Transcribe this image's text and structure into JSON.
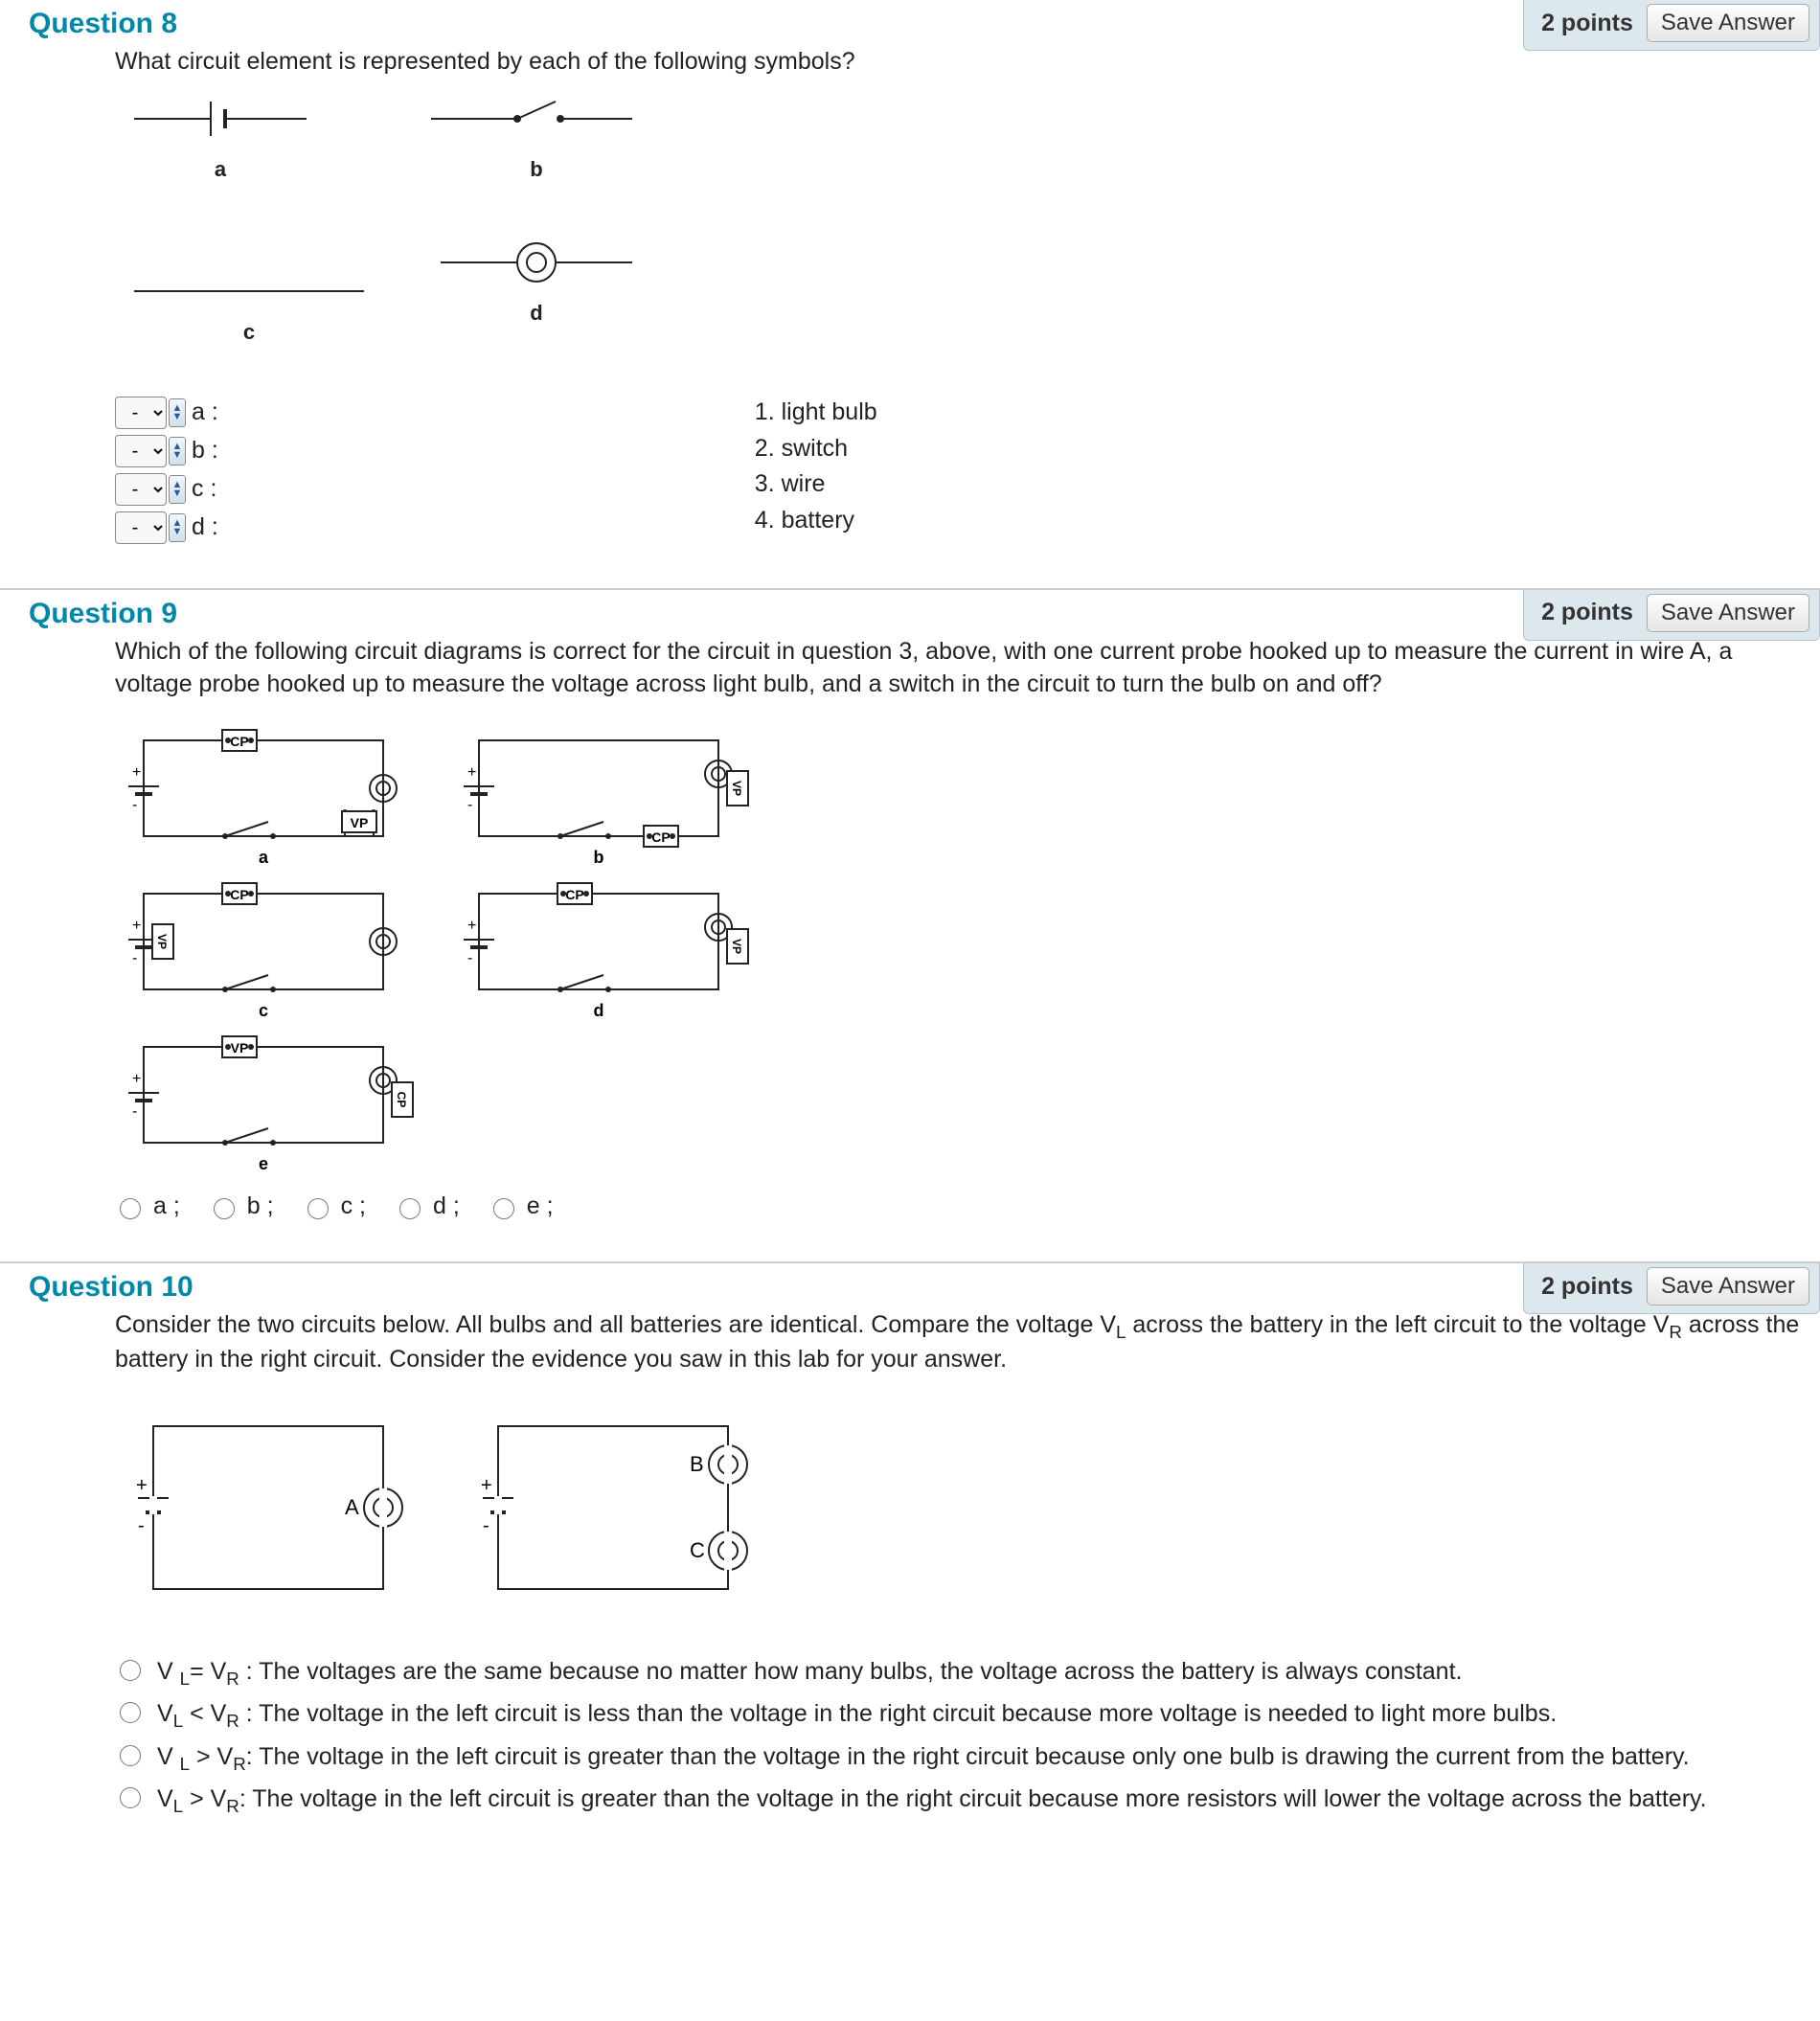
{
  "q8": {
    "number": "Question 8",
    "points": "2 points",
    "save": "Save Answer",
    "prompt": "What circuit element is represented by each of the following symbols?",
    "labels": {
      "a": "a",
      "b": "b",
      "c": "c",
      "d": "d"
    },
    "left_items": [
      "a :",
      "b :",
      "c :",
      "d :"
    ],
    "select_placeholder": "-",
    "right_items": [
      "1. light bulb",
      "2. switch",
      "3. wire",
      "4. battery"
    ]
  },
  "q9": {
    "number": "Question 9",
    "points": "2 points",
    "save": "Save Answer",
    "prompt": "Which of the following circuit diagrams is correct for the circuit in question 3, above, with one current probe hooked up to measure the current in wire A, a voltage probe hooked up to measure the voltage across light bulb, and a switch in the circuit to turn the bulb on and off?",
    "diag_labels": {
      "a": "a",
      "b": "b",
      "c": "c",
      "d": "d",
      "e": "e",
      "cp": "CP",
      "vp": "VP"
    },
    "options": [
      "a ;",
      "b ;",
      "c ;",
      "d ;",
      "e ;"
    ]
  },
  "q10": {
    "number": "Question 10",
    "points": "2 points",
    "save": "Save Answer",
    "prompt_pre": "Consider the two circuits below. All bulbs and all batteries are identical. Compare the voltage V",
    "prompt_l": "L",
    "prompt_mid": " across the battery in the left circuit to the voltage V",
    "prompt_r": "R",
    "prompt_post": " across the battery in the right circuit. Consider the evidence you saw in this lab for your answer.",
    "diag_labels": {
      "a": "A",
      "b": "B",
      "c": "C",
      "plus": "+",
      "minus": "-"
    },
    "options": [
      {
        "pre": "V ",
        "s1": "L",
        "mid1": "= V",
        "s2": "R",
        "post": " : The voltages are the same because no matter how many bulbs, the voltage across the battery is always constant."
      },
      {
        "pre": "V",
        "s1": "L",
        "mid1": " < V",
        "s2": "R",
        "post": " : The voltage in the left circuit is less than the voltage in the right circuit because more voltage is needed to light more bulbs."
      },
      {
        "pre": "V ",
        "s1": "L",
        "mid1": " > V",
        "s2": "R",
        "post": ": The voltage in the left circuit is greater than the voltage in the right circuit because only one bulb is drawing the current from the battery."
      },
      {
        "pre": "V",
        "s1": "L",
        "mid1": " > V",
        "s2": "R",
        "post": ": The voltage in the left circuit is greater than the voltage in the right circuit because more resistors will lower the voltage across the battery."
      }
    ]
  }
}
